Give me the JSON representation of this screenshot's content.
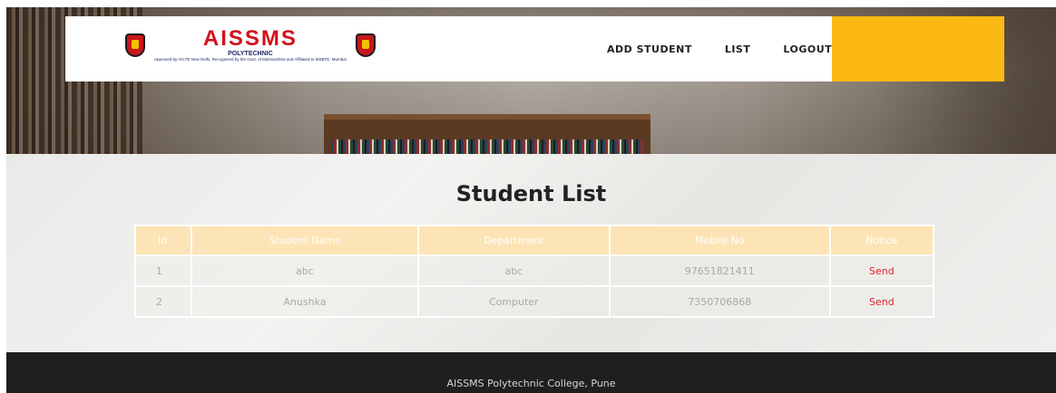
{
  "brand": {
    "name": "AISSMS",
    "subtitle": "POLYTECHNIC",
    "tagline": "Approved by AICTE New Delhi, Recognized by the Govt. of Maharashtra and Affiliated to MSBTE, Mumbai"
  },
  "nav": {
    "items": [
      {
        "label": "ADD STUDENT"
      },
      {
        "label": "LIST"
      },
      {
        "label": "LOGOUT"
      }
    ]
  },
  "page": {
    "title": "Student List"
  },
  "table": {
    "columns": [
      "Id",
      "Student Name",
      "Department",
      "Mobile No",
      "Notice"
    ],
    "rows": [
      {
        "id": "1",
        "name": "abc",
        "department": "abc",
        "mobile": "97651821411",
        "notice": "Send"
      },
      {
        "id": "2",
        "name": "Anushka",
        "department": "Computer",
        "mobile": "7350706868",
        "notice": "Send"
      }
    ]
  },
  "footer": {
    "text": "AISSMS Polytechnic College, Pune"
  },
  "colors": {
    "accent": "#fdb913",
    "header_bg": "#fce4b6",
    "link": "#e0222a",
    "brand_red": "#d0121b",
    "footer_bg": "#1f1f1f"
  }
}
